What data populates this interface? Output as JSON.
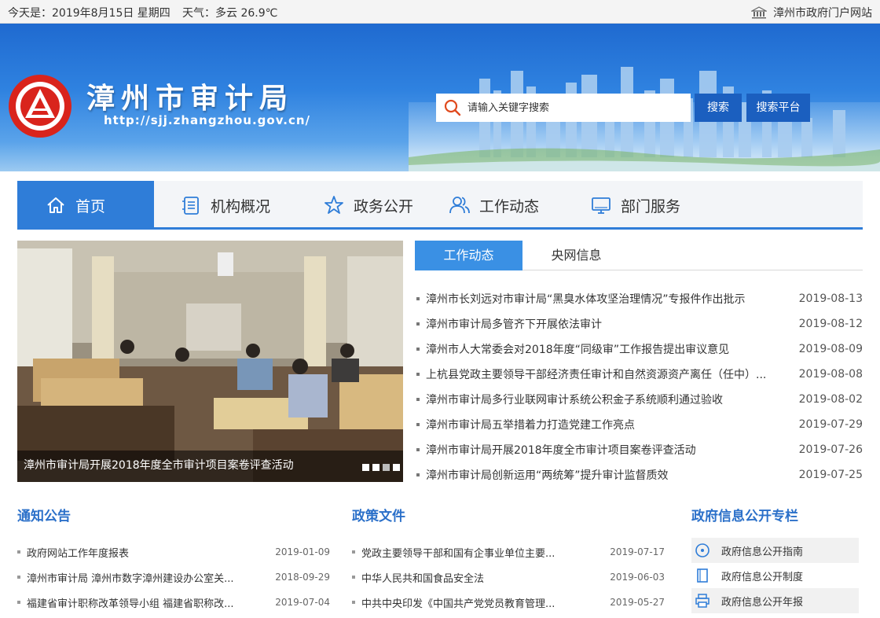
{
  "topbar": {
    "date": "今天是：2019年8月15日 星期四",
    "weather": "天气：多云 26.9℃",
    "portal_link": "漳州市政府门户网站",
    "portal_icon": "building-icon"
  },
  "header": {
    "title": "漳州市审计局",
    "url": "http://sjj.zhangzhou.gov.cn/",
    "search_placeholder": "请输入关键字搜索",
    "search_button": "搜索",
    "platform_button": "搜索平台"
  },
  "nav": [
    {
      "label": "首页",
      "icon": "home-icon",
      "active": true
    },
    {
      "label": "机构概况",
      "icon": "list-icon"
    },
    {
      "label": "政务公开",
      "icon": "star-icon"
    },
    {
      "label": "工作动态",
      "icon": "users-icon"
    },
    {
      "label": "部门服务",
      "icon": "monitor-icon"
    }
  ],
  "slider": {
    "caption": "漳州市审计局开展2018年度全市审计项目案卷评查活动",
    "dots": 4,
    "active_dot": 2
  },
  "news_tabs": [
    {
      "label": "工作动态",
      "active": true
    },
    {
      "label": "央网信息",
      "active": false
    }
  ],
  "news": [
    {
      "title": "漳州市长刘远对市审计局“黑臭水体攻坚治理情况”专报件作出批示",
      "date": "2019-08-13"
    },
    {
      "title": "漳州市审计局多管齐下开展依法审计",
      "date": "2019-08-12"
    },
    {
      "title": "漳州市人大常委会对2018年度“同级审”工作报告提出审议意见",
      "date": "2019-08-09"
    },
    {
      "title": "上杭县党政主要领导干部经济责任审计和自然资源资产离任（任中）...",
      "date": "2019-08-08"
    },
    {
      "title": "漳州市审计局多行业联网审计系统公积金子系统顺利通过验收",
      "date": "2019-08-02"
    },
    {
      "title": "漳州市审计局五举措着力打造党建工作亮点",
      "date": "2019-07-29"
    },
    {
      "title": "漳州市审计局开展2018年度全市审计项目案卷评查活动",
      "date": "2019-07-26"
    },
    {
      "title": "漳州市审计局创新运用“两统筹”提升审计监督质效",
      "date": "2019-07-25"
    }
  ],
  "notices": {
    "heading": "通知公告",
    "items": [
      {
        "title": "政府网站工作年度报表",
        "date": "2019-01-09"
      },
      {
        "title": "漳州市审计局 漳州市数字漳州建设办公室关...",
        "date": "2018-09-29"
      },
      {
        "title": "福建省审计职称改革领导小组 福建省职称改...",
        "date": "2019-07-04"
      }
    ]
  },
  "policies": {
    "heading": "政策文件",
    "items": [
      {
        "title": "党政主要领导干部和国有企事业单位主要...",
        "date": "2019-07-17"
      },
      {
        "title": "中华人民共和国食品安全法",
        "date": "2019-06-03"
      },
      {
        "title": "中共中央印发《中国共产党党员教育管理...",
        "date": "2019-05-27"
      }
    ]
  },
  "gov_info": {
    "heading": "政府信息公开专栏",
    "items": [
      {
        "label": "政府信息公开指南",
        "icon": "compass-icon"
      },
      {
        "label": "政府信息公开制度",
        "icon": "document-icon"
      },
      {
        "label": "政府信息公开年报",
        "icon": "printer-icon"
      }
    ]
  },
  "colors": {
    "primary": "#2f7dd8",
    "dark_button": "#1b5fbf",
    "heading": "#2b70c9",
    "emblem_red": "#d9241c"
  }
}
